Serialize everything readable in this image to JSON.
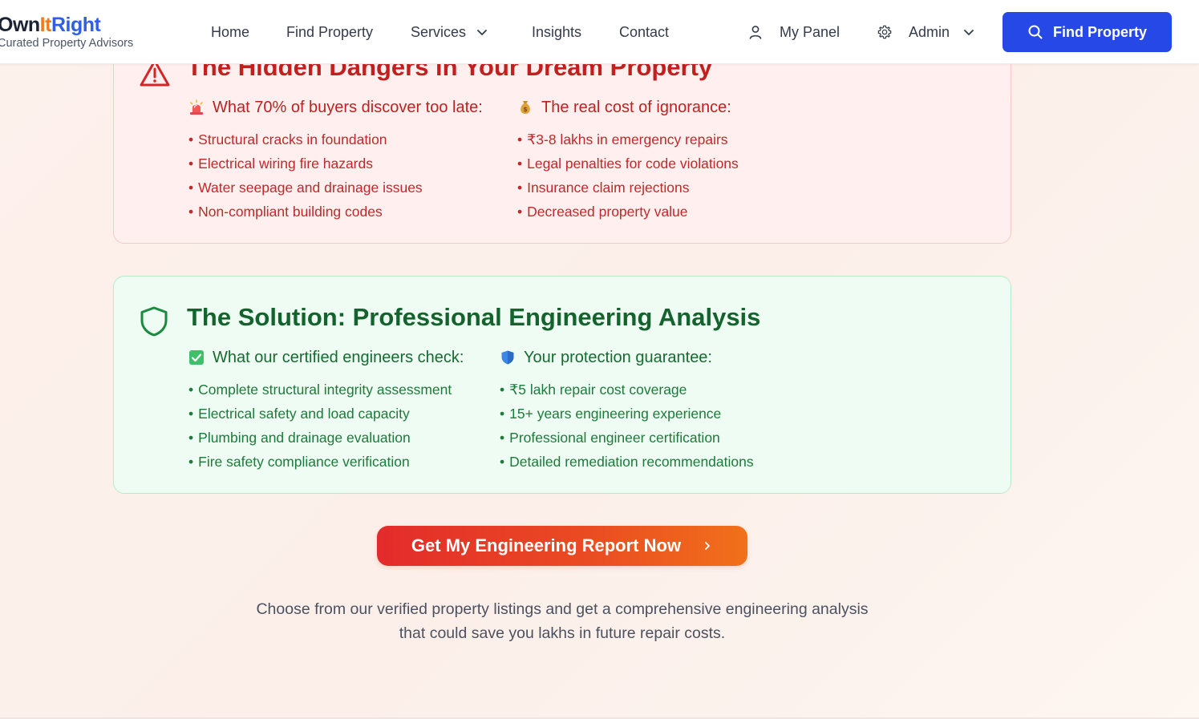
{
  "brand": {
    "name_part1": "Own",
    "name_part2": "It",
    "name_part3": "Right",
    "tagline": "Curated Property Advisors"
  },
  "nav": {
    "items": [
      {
        "label": "Home"
      },
      {
        "label": "Find Property"
      },
      {
        "label": "Services"
      },
      {
        "label": "Insights"
      },
      {
        "label": "Contact"
      }
    ],
    "my_panel": "My Panel",
    "admin": "Admin",
    "cta": "Find Property"
  },
  "danger": {
    "title": "The Hidden Dangers in Your Dream Property",
    "left": {
      "heading": "What 70% of buyers discover too late:",
      "items": [
        "Structural cracks in foundation",
        "Electrical wiring fire hazards",
        "Water seepage and drainage issues",
        "Non-compliant building codes"
      ]
    },
    "right": {
      "heading": "The real cost of ignorance:",
      "items": [
        "₹3-8 lakhs in emergency repairs",
        "Legal penalties for code violations",
        "Insurance claim rejections",
        "Decreased property value"
      ]
    }
  },
  "solution": {
    "title": "The Solution: Professional Engineering Analysis",
    "left": {
      "heading": "What our certified engineers check:",
      "items": [
        "Complete structural integrity assessment",
        "Electrical safety and load capacity",
        "Plumbing and drainage evaluation",
        "Fire safety compliance verification"
      ]
    },
    "right": {
      "heading": "Your protection guarantee:",
      "items": [
        "₹5 lakh repair cost coverage",
        "15+ years engineering experience",
        "Professional engineer certification",
        "Detailed remediation recommendations"
      ]
    }
  },
  "cta": {
    "label": "Get My Engineering Report Now"
  },
  "description": {
    "line1": "Choose from our verified property listings and get a comprehensive engineering analysis",
    "line2": "that could save you lakhs in future repair costs."
  },
  "colors": {
    "primary": "#2548e6",
    "danger": "#c21f1f",
    "success": "#14632d",
    "accent_orange": "#f07b1d"
  }
}
